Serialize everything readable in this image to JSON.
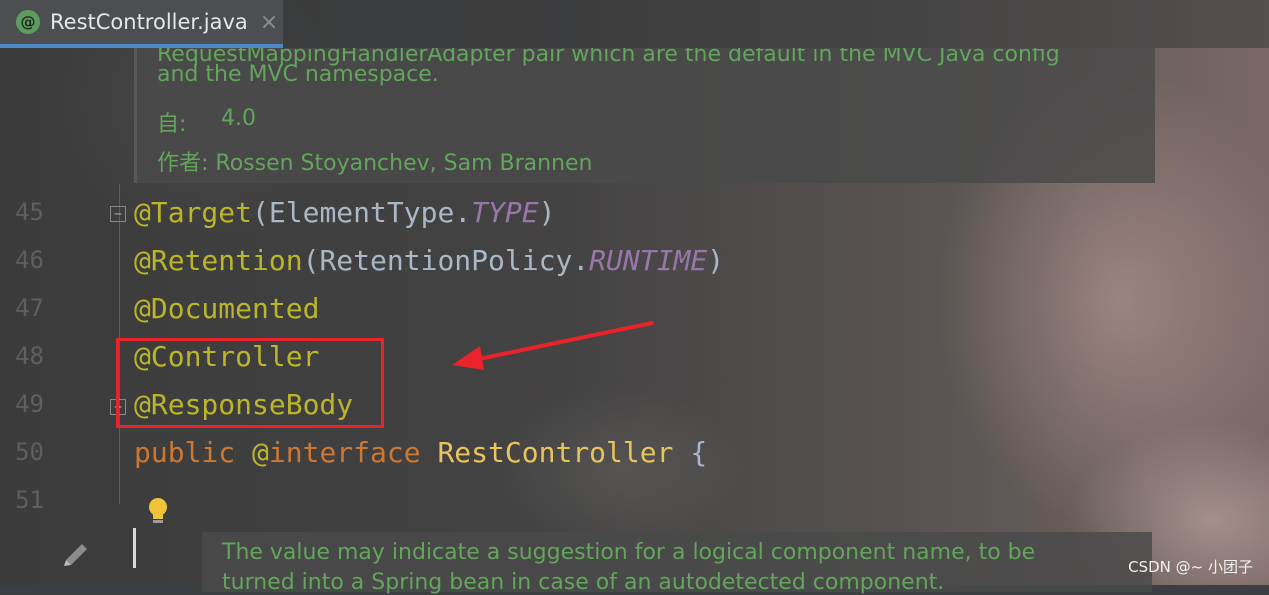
{
  "editor": {
    "tab": {
      "icon": "@",
      "title": "RestController.java",
      "close": "×"
    },
    "doc_top": {
      "partial_line": "RequestMappingHandlerAdapter pair which are the default in the MVC Java config",
      "line": "and the MVC namespace.",
      "since_label": "自:",
      "since_value": "4.0",
      "author": "作者: Rossen Stoyanchev, Sam Brannen"
    },
    "line_numbers": [
      "45",
      "46",
      "47",
      "48",
      "49",
      "50",
      "51"
    ],
    "code": {
      "l45": {
        "ann": "@Target",
        "open": "(",
        "cls": "ElementType",
        "dot": ".",
        "const": "TYPE",
        "close": ")"
      },
      "l46": {
        "ann": "@Retention",
        "open": "(",
        "cls": "RetentionPolicy",
        "dot": ".",
        "const": "RUNTIME",
        "close": ")"
      },
      "l47": {
        "ann": "@Documented"
      },
      "l48": {
        "ann": "@Controller"
      },
      "l49": {
        "ann": "@ResponseBody"
      },
      "l50": {
        "kw1": "public",
        "at": "@",
        "kw2": "interface",
        "name": "RestController",
        "brace": "{"
      }
    },
    "doc_bottom": {
      "line1": "The value may indicate a suggestion for a logical component name, to be",
      "line2": "turned into a Spring bean in case of an autodetected component."
    },
    "icons": {
      "bulb": "lightbulb-icon",
      "pencil": "pencil-icon"
    },
    "colors": {
      "annotation": "#bbb529",
      "keyword": "#cc7832",
      "constant": "#9876aa",
      "doc_text": "#62a55b",
      "highlight": "#e8232a",
      "tab_underline": "#4a88c7"
    }
  },
  "watermark": "CSDN @~ 小团子"
}
